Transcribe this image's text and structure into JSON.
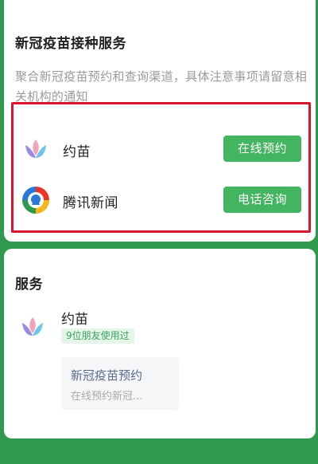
{
  "top_card": {
    "title": "新冠疫苗接种服务",
    "description": "聚合新冠疫苗预约和查询渠道，具体注意事项请留意相关机构的通知",
    "providers": [
      {
        "name": "约苗",
        "icon": "yuemiao-logo-icon",
        "action": "在线预约"
      },
      {
        "name": "腾讯新闻",
        "icon": "tencent-news-logo-icon",
        "action": "电话咨询"
      }
    ]
  },
  "services_card": {
    "title": "服务",
    "service": {
      "name": "约苗",
      "icon": "yuemiao-logo-icon",
      "badge": "9位朋友使用过",
      "mini_card": {
        "title": "新冠疫苗预约",
        "subtitle": "在线预约新冠..."
      }
    }
  },
  "colors": {
    "background": "#2f9a4f",
    "button": "#43b45f",
    "highlight": "#d8142e"
  }
}
